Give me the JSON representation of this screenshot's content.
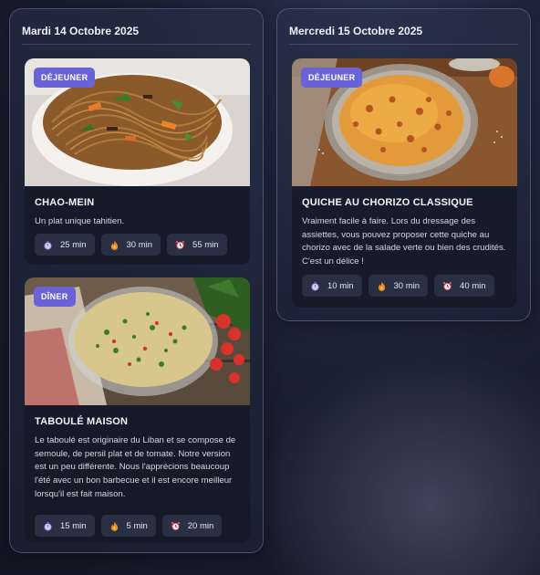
{
  "days": [
    {
      "title": "Mardi 14 Octobre 2025",
      "meals": [
        {
          "badge": "DÉJEUNER",
          "name": "CHAO-MEIN",
          "description": "Un plat unique tahitien.",
          "prep": "25 min",
          "cook": "30 min",
          "total": "55 min",
          "image": "noodles-bowl-photo"
        },
        {
          "badge": "DÎNER",
          "name": "TABOULÉ MAISON",
          "description": "Le taboulé est originaire du Liban et se compose de semoule, de persil plat et de tomate. Notre version est un peu différente. Nous l'apprécions beaucoup l'été avec un bon barbecue et il est encore meilleur lorsqu'il est fait maison.",
          "prep": "15 min",
          "cook": "5 min",
          "total": "20 min",
          "image": "tabbouleh-bowl-photo"
        }
      ]
    },
    {
      "title": "Mercredi 15 Octobre 2025",
      "meals": [
        {
          "badge": "DÉJEUNER",
          "name": "QUICHE AU CHORIZO CLASSIQUE",
          "description": "Vraiment facile à faire. Lors du dressage des assiettes, vous pouvez proposer cette quiche au chorizo avec de la salade verte ou bien des crudités. C'est un délice !",
          "prep": "10 min",
          "cook": "30 min",
          "total": "40 min",
          "image": "quiche-dish-photo"
        }
      ]
    }
  ],
  "icons": {
    "prep": "stopwatch-icon",
    "cook": "flame-icon",
    "total": "alarm-clock-icon"
  },
  "colors": {
    "badge": "#6a63d8",
    "flame": "#f08a24",
    "alarm": "#e84a5f"
  }
}
